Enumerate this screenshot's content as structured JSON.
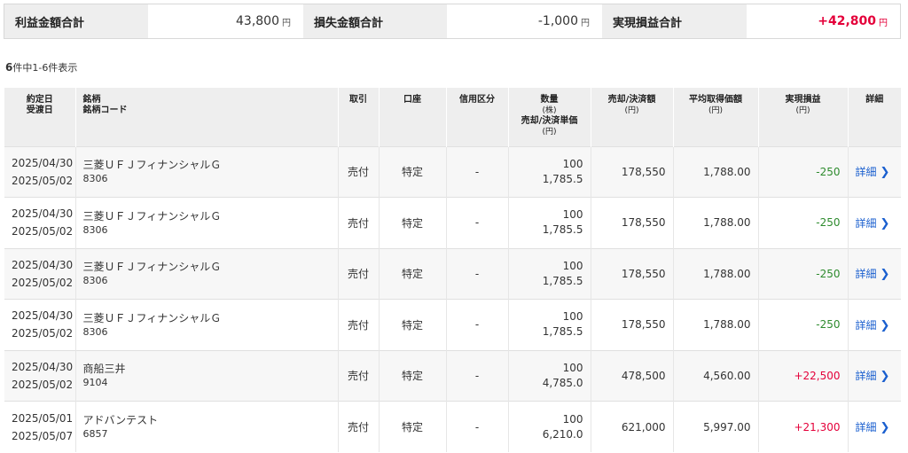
{
  "summary": {
    "profit_label": "利益金額合計",
    "profit_value": "43,800",
    "loss_label": "損失金額合計",
    "loss_value": "-1,000",
    "realized_label": "実現損益合計",
    "realized_value": "+42,800",
    "unit": "円"
  },
  "count": {
    "number": "6",
    "text": "件中1-6件表示"
  },
  "table": {
    "headers": {
      "date_line1": "約定日",
      "date_line2": "受渡日",
      "stock_line1": "銘柄",
      "stock_line2": "銘柄コード",
      "trade": "取引",
      "account": "口座",
      "margin": "信用区分",
      "qty_line1": "数量",
      "qty_unit1": "(株)",
      "qty_line2": "売却/決済単価",
      "qty_unit2": "(円)",
      "sale_line1": "売却/決済額",
      "sale_unit": "(円)",
      "avg_line1": "平均取得価額",
      "avg_unit": "(円)",
      "pl_line1": "実現損益",
      "pl_unit": "(円)",
      "detail": "詳細"
    },
    "rows": [
      {
        "trade_date": "2025/04/30",
        "settle_date": "2025/05/02",
        "name": "三菱ＵＦＪフィナンシャルＧ",
        "code": "8306",
        "trade": "売付",
        "account": "特定",
        "margin": "-",
        "qty": "100",
        "price": "1,785.5",
        "sale": "178,550",
        "avg": "1,788.00",
        "pl": "-250",
        "detail": "詳細"
      },
      {
        "trade_date": "2025/04/30",
        "settle_date": "2025/05/02",
        "name": "三菱ＵＦＪフィナンシャルＧ",
        "code": "8306",
        "trade": "売付",
        "account": "特定",
        "margin": "-",
        "qty": "100",
        "price": "1,785.5",
        "sale": "178,550",
        "avg": "1,788.00",
        "pl": "-250",
        "detail": "詳細"
      },
      {
        "trade_date": "2025/04/30",
        "settle_date": "2025/05/02",
        "name": "三菱ＵＦＪフィナンシャルＧ",
        "code": "8306",
        "trade": "売付",
        "account": "特定",
        "margin": "-",
        "qty": "100",
        "price": "1,785.5",
        "sale": "178,550",
        "avg": "1,788.00",
        "pl": "-250",
        "detail": "詳細"
      },
      {
        "trade_date": "2025/04/30",
        "settle_date": "2025/05/02",
        "name": "三菱ＵＦＪフィナンシャルＧ",
        "code": "8306",
        "trade": "売付",
        "account": "特定",
        "margin": "-",
        "qty": "100",
        "price": "1,785.5",
        "sale": "178,550",
        "avg": "1,788.00",
        "pl": "-250",
        "detail": "詳細"
      },
      {
        "trade_date": "2025/04/30",
        "settle_date": "2025/05/02",
        "name": "商船三井",
        "code": "9104",
        "trade": "売付",
        "account": "特定",
        "margin": "-",
        "qty": "100",
        "price": "4,785.0",
        "sale": "478,500",
        "avg": "4,560.00",
        "pl": "+22,500",
        "detail": "詳細"
      },
      {
        "trade_date": "2025/05/01",
        "settle_date": "2025/05/07",
        "name": "アドバンテスト",
        "code": "6857",
        "trade": "売付",
        "account": "特定",
        "margin": "-",
        "qty": "100",
        "price": "6,210.0",
        "sale": "621,000",
        "avg": "5,997.00",
        "pl": "+21,300",
        "detail": "詳細"
      }
    ]
  },
  "colors": {
    "negative": "#2e8b2e",
    "positive": "#e4003a",
    "link": "#1a5fcf",
    "header_bg": "#eeeeee"
  },
  "icons": {
    "detail_chevron": "chevron-right-icon"
  }
}
